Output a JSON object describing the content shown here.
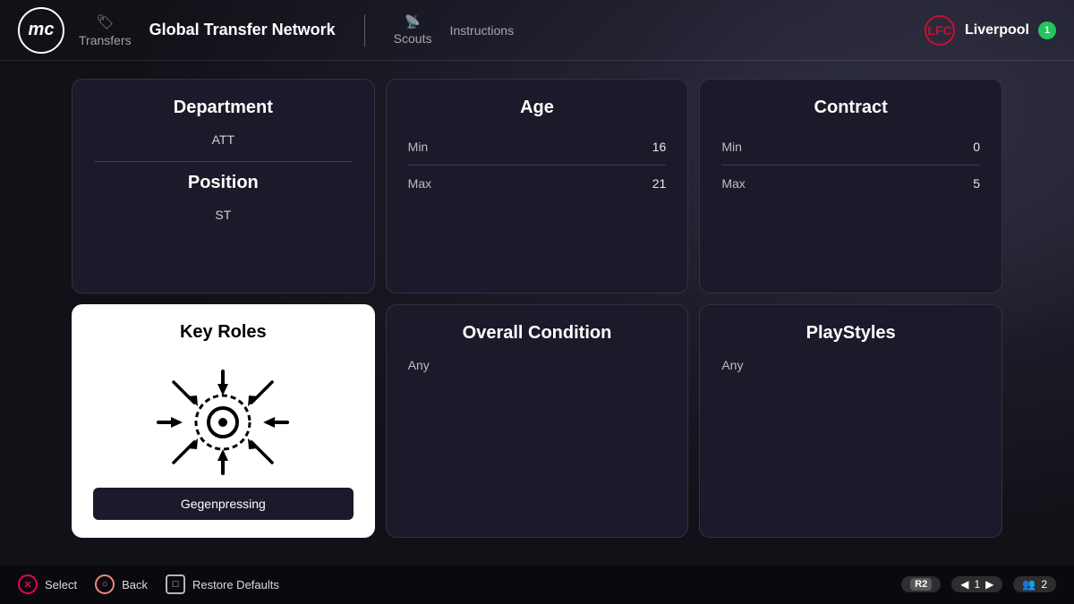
{
  "app": {
    "logo": "mc"
  },
  "header": {
    "transfers_label": "Transfers",
    "active_nav": "Global Transfer Network",
    "scouts_icon": "🔍",
    "scouts_label": "Scouts",
    "instructions_label": "Instructions",
    "club_name": "Liverpool",
    "notification_count": "1"
  },
  "cards": {
    "department": {
      "title": "Department",
      "value": "ATT",
      "position_title": "Position",
      "position_value": "ST"
    },
    "age": {
      "title": "Age",
      "min_label": "Min",
      "min_value": "16",
      "max_label": "Max",
      "max_value": "21"
    },
    "contract": {
      "title": "Contract",
      "min_label": "Min",
      "min_value": "0",
      "max_label": "Max",
      "max_value": "5"
    },
    "key_roles": {
      "title": "Key Roles",
      "badge": "Gegenpressing"
    },
    "overall_condition": {
      "title": "Overall Condition",
      "value": "Any"
    },
    "playstyles": {
      "title": "PlayStyles",
      "value": "Any"
    }
  },
  "footer": {
    "select_label": "Select",
    "back_label": "Back",
    "restore_label": "Restore Defaults",
    "r2_label": "R2",
    "r_value": "1",
    "group_value": "2"
  }
}
